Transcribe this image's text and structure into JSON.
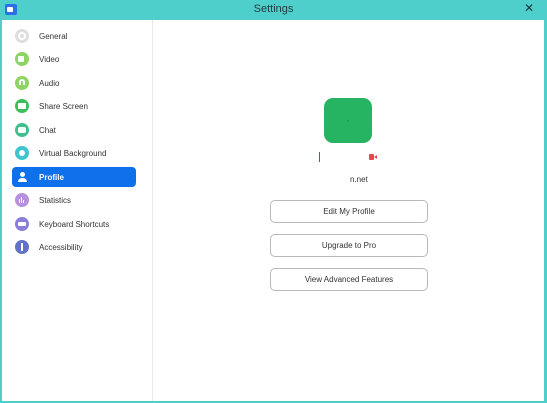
{
  "window": {
    "title": "Settings",
    "close_glyph": "✕"
  },
  "sidebar": {
    "items": [
      {
        "label": "General",
        "icon": "gear-icon"
      },
      {
        "label": "Video",
        "icon": "video-icon"
      },
      {
        "label": "Audio",
        "icon": "headphones-icon"
      },
      {
        "label": "Share Screen",
        "icon": "share-screen-icon"
      },
      {
        "label": "Chat",
        "icon": "chat-icon"
      },
      {
        "label": "Virtual Background",
        "icon": "virtual-background-icon"
      },
      {
        "label": "Profile",
        "icon": "person-icon",
        "active": true
      },
      {
        "label": "Statistics",
        "icon": "bar-chart-icon"
      },
      {
        "label": "Keyboard Shortcuts",
        "icon": "keyboard-icon"
      },
      {
        "label": "Accessibility",
        "icon": "accessibility-icon"
      }
    ]
  },
  "profile": {
    "email": "n.net",
    "buttons": {
      "edit": "Edit My Profile",
      "upgrade": "Upgrade to Pro",
      "advanced": "View Advanced Features"
    }
  },
  "colors": {
    "window_frame": "#4fcfcc",
    "active_nav": "#0e71eb",
    "avatar": "#26b462",
    "video_icon": "#e5484d"
  }
}
